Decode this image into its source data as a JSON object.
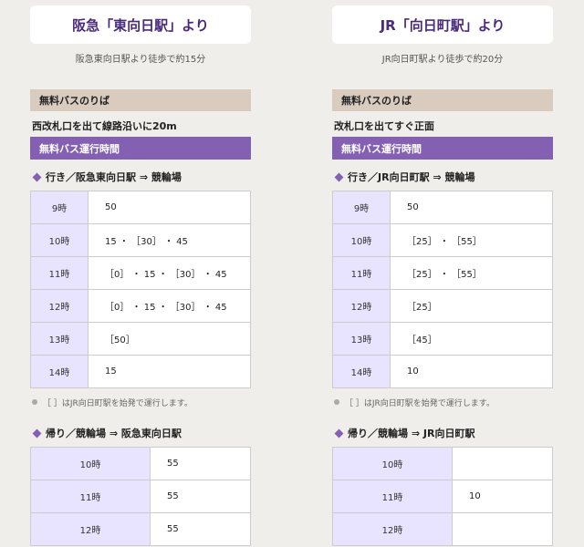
{
  "columns": [
    {
      "station_title": "阪急「東向日駅」より",
      "walk": "阪急東向日駅より徒歩で約15分",
      "stop_heading": "無料バスのりば",
      "stop_text": "西改札口を出て線路沿いに20m",
      "hours_heading": "無料バス運行時間",
      "outbound_title": "行き／阪急東向日駅 ⇒ 競輪場",
      "outbound": [
        {
          "hour": "9時",
          "minutes": "50"
        },
        {
          "hour": "10時",
          "minutes": "15 ・ ［30］ ・ 45"
        },
        {
          "hour": "11時",
          "minutes": "［0］ ・ 15 ・ ［30］ ・ 45"
        },
        {
          "hour": "12時",
          "minutes": "［0］ ・ 15 ・ ［30］ ・ 45"
        },
        {
          "hour": "13時",
          "minutes": "［50］"
        },
        {
          "hour": "14時",
          "minutes": "15"
        }
      ],
      "note": "［ ］はJR向日町駅を始発で運行します。",
      "return_title": "帰り／競輪場 ⇒ 阪急東向日駅",
      "return": [
        {
          "hour": "10時",
          "minutes": "55"
        },
        {
          "hour": "11時",
          "minutes": "55"
        },
        {
          "hour": "12時",
          "minutes": "55"
        }
      ]
    },
    {
      "station_title": "JR「向日町駅」より",
      "walk": "JR向日町駅より徒歩で約20分",
      "stop_heading": "無料バスのりば",
      "stop_text": "改札口を出てすぐ正面",
      "hours_heading": "無料バス運行時間",
      "outbound_title": "行き／JR向日町駅 ⇒ 競輪場",
      "outbound": [
        {
          "hour": "9時",
          "minutes": "50"
        },
        {
          "hour": "10時",
          "minutes": "［25］ ・ ［55］"
        },
        {
          "hour": "11時",
          "minutes": "［25］ ・ ［55］"
        },
        {
          "hour": "12時",
          "minutes": "［25］"
        },
        {
          "hour": "13時",
          "minutes": "［45］"
        },
        {
          "hour": "14時",
          "minutes": "10"
        }
      ],
      "note": "［ ］はJR向日町駅を始発で運行します。",
      "return_title": "帰り／競輪場 ⇒ JR向日町駅",
      "return": [
        {
          "hour": "10時",
          "minutes": ""
        },
        {
          "hour": "11時",
          "minutes": "10"
        },
        {
          "hour": "12時",
          "minutes": ""
        }
      ]
    }
  ],
  "colors": {
    "accent": "#8460b3",
    "stop_heading_bg": "#d9ccbf",
    "hour_cell_bg": "#e8e4ff",
    "title_text": "#4a2a7b"
  }
}
